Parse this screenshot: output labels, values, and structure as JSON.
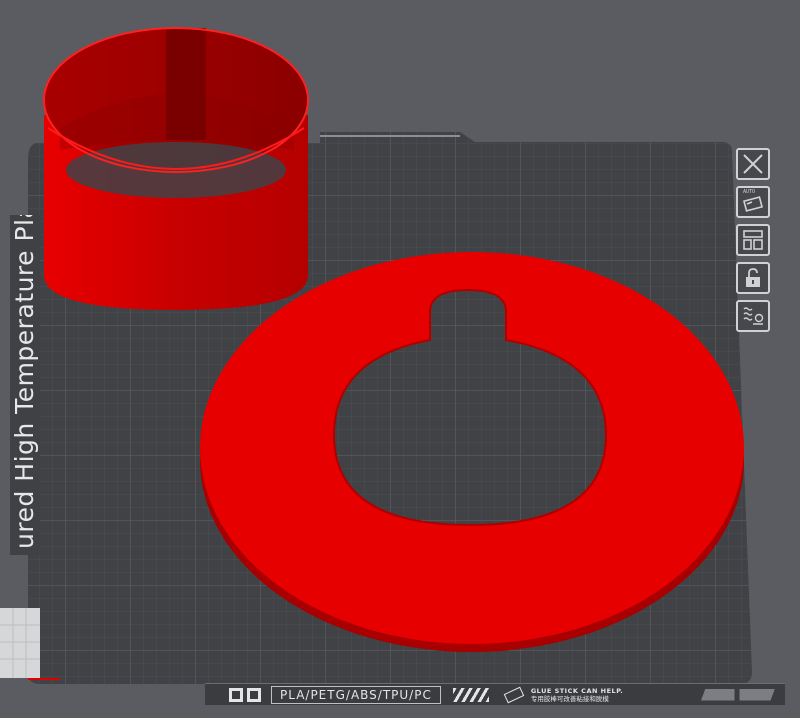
{
  "plate": {
    "name_label": "ured High Temperature Plate",
    "materials_label": "PLA/PETG/ABS/TPU/PC",
    "glue_hint": "GLUE STICK CAN HELP.",
    "glue_hint_cn": "专用胶棒可改善粘接和脱模",
    "tool_badge": "AUTO"
  },
  "toolbar": {
    "items": [
      {
        "name": "delete-plate-button",
        "icon": "close-icon"
      },
      {
        "name": "auto-orient-button",
        "icon": "auto-orient-icon"
      },
      {
        "name": "arrange-button",
        "icon": "arrange-icon"
      },
      {
        "name": "lock-plate-button",
        "icon": "unlock-icon"
      },
      {
        "name": "plate-settings-button",
        "icon": "heat-settings-icon"
      }
    ]
  },
  "colors": {
    "background": "#5a5c61",
    "plate": "#404246",
    "grid": "#55575c",
    "model_red": "#e00000",
    "model_red_dark": "#b00000",
    "ui_light": "#cfd1d4"
  }
}
